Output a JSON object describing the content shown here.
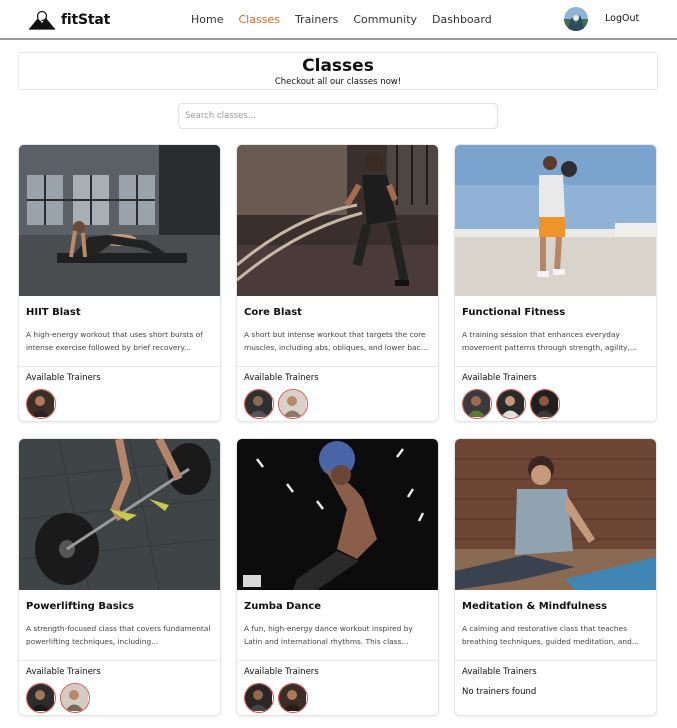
{
  "brand": {
    "name": "fitStat"
  },
  "nav": {
    "links": [
      "Home",
      "Classes",
      "Trainers",
      "Community",
      "Dashboard"
    ],
    "active": "Classes",
    "logout_label": "LogOut"
  },
  "header": {
    "title": "Classes",
    "subtitle": "Checkout all our classes now!"
  },
  "search": {
    "placeholder": "Search classes...",
    "value": ""
  },
  "colors": {
    "accent": "#e06a2a",
    "avatar_ring": "#d9534f"
  },
  "trainers_label": "Available Trainers",
  "no_trainers_text": "No trainers found",
  "classes": [
    {
      "title": "HIIT Blast",
      "description": "A high-energy workout that uses short bursts of intense exercise followed by brief recovery...",
      "trainers": 1
    },
    {
      "title": "Core Blast",
      "description": "A short but intense workout that targets the core muscles, including abs, obliques, and lower bac...",
      "trainers": 2
    },
    {
      "title": "Functional Fitness",
      "description": "A training session that enhances everyday movement patterns through strength, agility,...",
      "trainers": 3
    },
    {
      "title": "Powerlifting Basics",
      "description": "A strength-focused class that covers fundamental powerlifting techniques, including...",
      "trainers": 2
    },
    {
      "title": "Zumba Dance",
      "description": "A fun, high-energy dance workout inspired by Latin and international rhythms. This class...",
      "trainers": 2
    },
    {
      "title": "Meditation & Mindfulness",
      "description": "A calming and restorative class that teaches breathing techniques, guided meditation, and...",
      "trainers": 0
    }
  ]
}
